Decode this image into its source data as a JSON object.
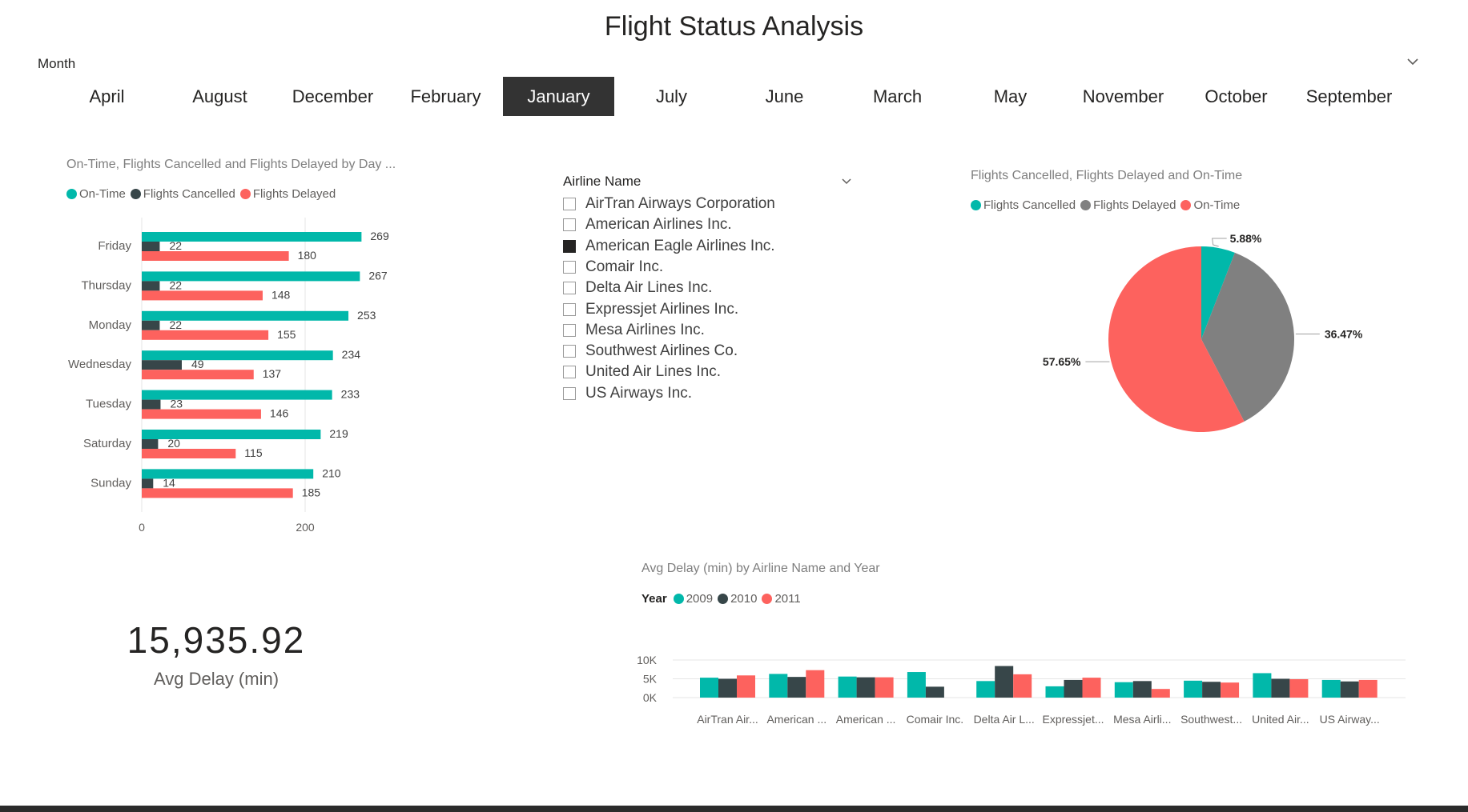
{
  "page": {
    "title": "Flight Status Analysis"
  },
  "month_slicer": {
    "label": "Month",
    "selected": "January",
    "options": [
      "April",
      "August",
      "December",
      "February",
      "January",
      "July",
      "June",
      "March",
      "May",
      "November",
      "October",
      "September"
    ]
  },
  "colors": {
    "teal": "#01b8aa",
    "dark": "#374649",
    "red": "#fd625e",
    "gray": "#808080"
  },
  "icons": {
    "dropdown": "chevron-down-icon"
  },
  "day_chart": {
    "title": "On-Time, Flights Cancelled and Flights Delayed by Day ...",
    "legend": [
      "On-Time",
      "Flights Cancelled",
      "Flights Delayed"
    ]
  },
  "airline_slicer": {
    "title": "Airline Name",
    "items": [
      {
        "label": "AirTran Airways Corporation",
        "checked": false
      },
      {
        "label": "American Airlines Inc.",
        "checked": false
      },
      {
        "label": "American Eagle Airlines Inc.",
        "checked": true
      },
      {
        "label": "Comair Inc.",
        "checked": false
      },
      {
        "label": "Delta Air Lines Inc.",
        "checked": false
      },
      {
        "label": "Expressjet Airlines Inc.",
        "checked": false
      },
      {
        "label": "Mesa Airlines Inc.",
        "checked": false
      },
      {
        "label": "Southwest Airlines Co.",
        "checked": false
      },
      {
        "label": "United Air Lines Inc.",
        "checked": false
      },
      {
        "label": "US Airways Inc.",
        "checked": false
      }
    ]
  },
  "pie_chart": {
    "title": "Flights Cancelled, Flights Delayed and On-Time",
    "legend": [
      "Flights Cancelled",
      "Flights Delayed",
      "On-Time"
    ]
  },
  "avg_delay_chart": {
    "title": "Avg Delay (min) by Airline Name and Year",
    "legend_title": "Year",
    "legend": [
      "2009",
      "2010",
      "2011"
    ]
  },
  "kpi": {
    "value": "15,935.92",
    "label": "Avg Delay (min)"
  },
  "chart_data": [
    {
      "type": "bar",
      "orientation": "horizontal",
      "title": "On-Time, Flights Cancelled and Flights Delayed by Day ...",
      "categories": [
        "Friday",
        "Thursday",
        "Monday",
        "Wednesday",
        "Tuesday",
        "Saturday",
        "Sunday"
      ],
      "series": [
        {
          "name": "On-Time",
          "values": [
            269,
            267,
            253,
            234,
            233,
            219,
            210
          ]
        },
        {
          "name": "Flights Cancelled",
          "values": [
            22,
            22,
            22,
            49,
            23,
            20,
            14
          ]
        },
        {
          "name": "Flights Delayed",
          "values": [
            180,
            148,
            155,
            137,
            146,
            115,
            185
          ]
        }
      ],
      "xlim": [
        0,
        400
      ],
      "xticks": [
        "0",
        "200"
      ],
      "legend_position": "top-left",
      "grid": true
    },
    {
      "type": "pie",
      "title": "Flights Cancelled, Flights Delayed and On-Time",
      "slices": [
        {
          "name": "Flights Cancelled",
          "value": 5.88,
          "label": "5.88%"
        },
        {
          "name": "Flights Delayed",
          "value": 36.47,
          "label": "36.47%"
        },
        {
          "name": "On-Time",
          "value": 57.65,
          "label": "57.65%"
        }
      ],
      "legend_position": "top-left"
    },
    {
      "type": "bar",
      "orientation": "vertical",
      "title": "Avg Delay (min) by Airline Name and Year",
      "categories": [
        "AirTran Air...",
        "American ...",
        "American ...",
        "Comair Inc.",
        "Delta Air L...",
        "Expressjet...",
        "Mesa Airli...",
        "Southwest...",
        "United Air...",
        "US Airway..."
      ],
      "series": [
        {
          "name": "2009",
          "values": [
            5300,
            6300,
            5600,
            6800,
            4400,
            3000,
            4100,
            4500,
            6500,
            4700
          ]
        },
        {
          "name": "2010",
          "values": [
            5000,
            5500,
            5400,
            2900,
            8400,
            4700,
            4400,
            4200,
            5000,
            4300
          ]
        },
        {
          "name": "2011",
          "values": [
            5900,
            7300,
            5400,
            null,
            6200,
            5300,
            2300,
            4000,
            4900,
            4700
          ]
        }
      ],
      "ylim": [
        0,
        10000
      ],
      "yticks": [
        "0K",
        "5K",
        "10K"
      ],
      "legend_position": "top-left",
      "grid": true
    }
  ]
}
